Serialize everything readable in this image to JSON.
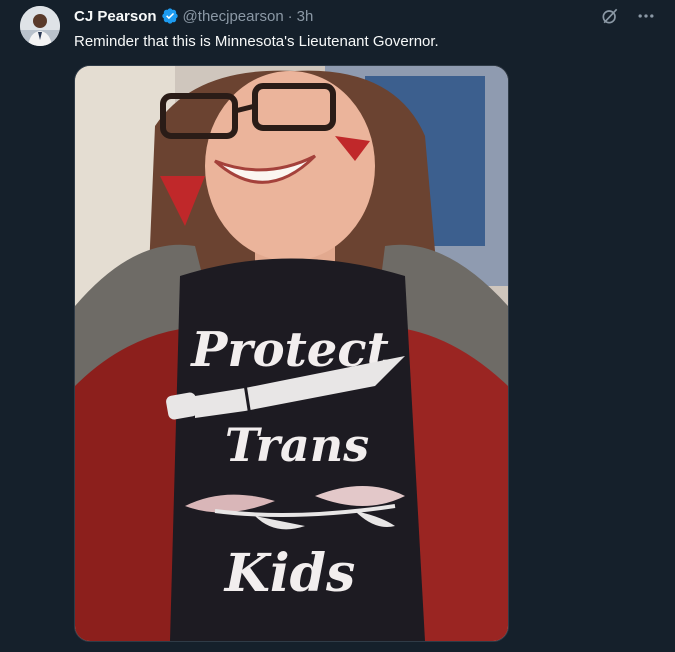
{
  "author": {
    "name": "CJ Pearson",
    "handle": "@thecjpearson",
    "time": "3h",
    "verified": true
  },
  "tweet": {
    "text": "Reminder that this is Minnesota's Lieutenant Governor."
  },
  "media": {
    "shirt_text": [
      "Protect",
      "Trans",
      "Kids"
    ]
  },
  "icons": {
    "verified": "verified-badge-icon",
    "grok": "grok-icon",
    "more": "more-icon"
  },
  "colors": {
    "background": "#15202b",
    "text": "#f7f9f9",
    "secondary": "#8b98a5",
    "verified": "#1d9bf0"
  }
}
